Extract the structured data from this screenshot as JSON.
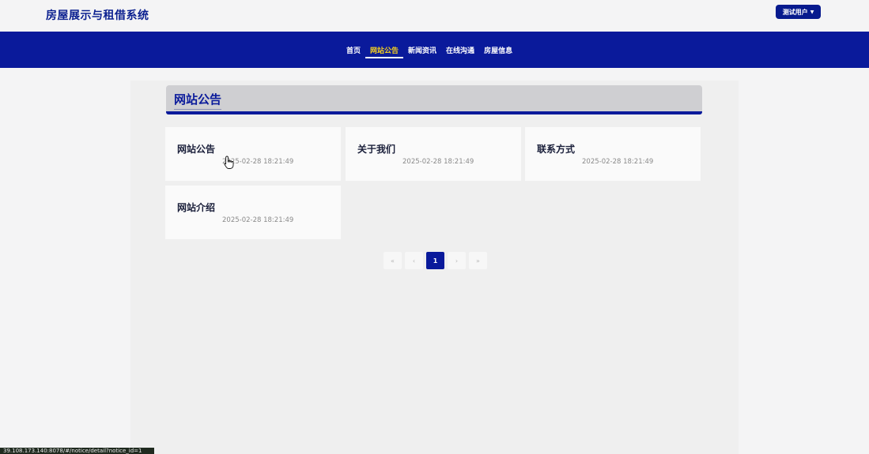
{
  "header": {
    "site_title": "房屋展示与租借系统",
    "user_button": "测试用户"
  },
  "nav": {
    "items": [
      {
        "label": "首页"
      },
      {
        "label": "网站公告"
      },
      {
        "label": "新闻资讯"
      },
      {
        "label": "在线沟通"
      },
      {
        "label": "房屋信息"
      }
    ],
    "active_index": 1
  },
  "main": {
    "section_title": "网站公告",
    "cards": [
      {
        "title": "网站公告",
        "date": "2025-02-28 18:21:49"
      },
      {
        "title": "关于我们",
        "date": "2025-02-28 18:21:49"
      },
      {
        "title": "联系方式",
        "date": "2025-02-28 18:21:49"
      },
      {
        "title": "网站介绍",
        "date": "2025-02-28 18:21:49"
      }
    ]
  },
  "pagination": {
    "first": "«",
    "prev": "‹",
    "current": "1",
    "next": "›",
    "last": "»"
  },
  "status_bar": {
    "url": "39.108.173.140:8078/#/notice/detail?notice_id=1"
  },
  "colors": {
    "brand_blue": "#0a1a9b",
    "active_nav": "#f5d01e"
  }
}
